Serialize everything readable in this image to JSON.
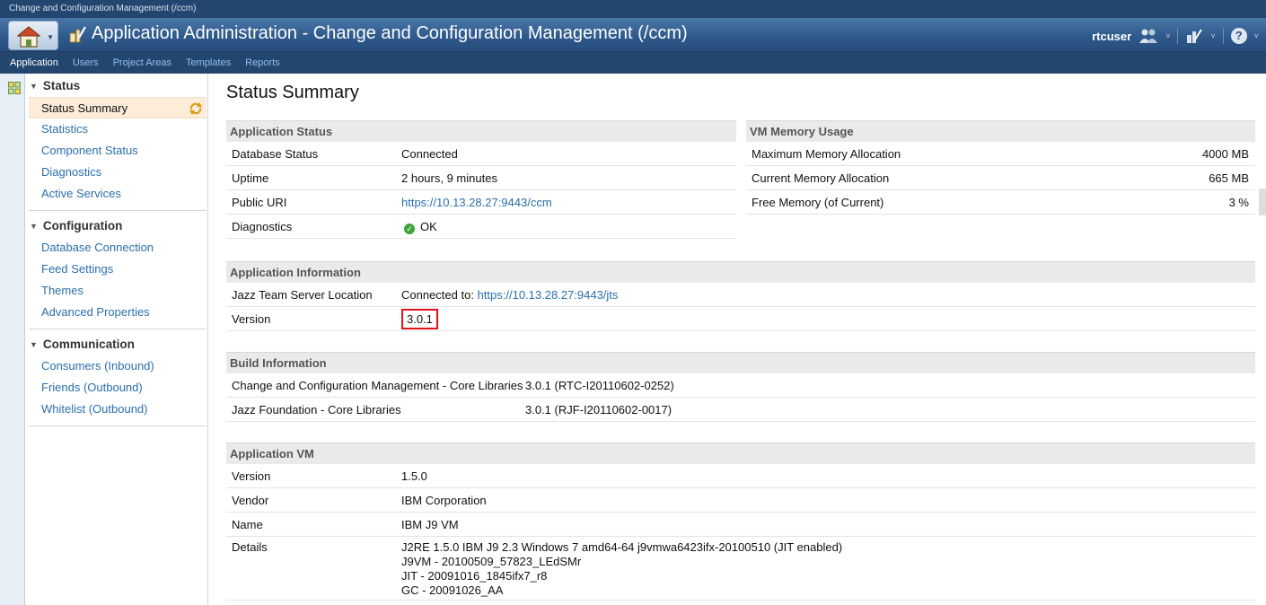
{
  "window": {
    "title": "Change and Configuration Management (/ccm)"
  },
  "banner": {
    "title": "Application Administration - Change and Configuration Management (/ccm)",
    "user": "rtcuser",
    "icons": [
      "home-icon",
      "admin-app-icon",
      "users-group-icon",
      "tools-icon",
      "help-icon"
    ]
  },
  "nav": {
    "tabs": [
      "Application",
      "Users",
      "Project Areas",
      "Templates",
      "Reports"
    ],
    "active": "Application"
  },
  "sidebar": {
    "sections": [
      {
        "title": "Status",
        "items": [
          "Status Summary",
          "Statistics",
          "Component Status",
          "Diagnostics",
          "Active Services"
        ]
      },
      {
        "title": "Configuration",
        "items": [
          "Database Connection",
          "Feed Settings",
          "Themes",
          "Advanced Properties"
        ]
      },
      {
        "title": "Communication",
        "items": [
          "Consumers (Inbound)",
          "Friends (Outbound)",
          "Whitelist (Outbound)"
        ]
      }
    ],
    "selected": "Status Summary"
  },
  "main": {
    "title": "Status Summary",
    "app_status": {
      "heading": "Application Status",
      "rows": [
        {
          "label": "Database Status",
          "value": "Connected"
        },
        {
          "label": "Uptime",
          "value": "2 hours, 9 minutes"
        },
        {
          "label": "Public URI",
          "value": "https://10.13.28.27:9443/ccm"
        },
        {
          "label": "Diagnostics",
          "value": "OK"
        }
      ]
    },
    "vm_memory": {
      "heading": "VM Memory Usage",
      "rows": [
        {
          "label": "Maximum Memory Allocation",
          "value": "4000 MB"
        },
        {
          "label": "Current Memory Allocation",
          "value": "665 MB"
        },
        {
          "label": "Free Memory (of Current)",
          "value": "3 %"
        }
      ]
    },
    "app_info": {
      "heading": "Application Information",
      "jts_label": "Jazz Team Server Location",
      "jts_prefix": "Connected to:",
      "jts_url": "https://10.13.28.27:9443/jts",
      "version_label": "Version",
      "version_value": "3.0.1"
    },
    "build_info": {
      "heading": "Build Information",
      "rows": [
        {
          "label": "Change and Configuration Management - Core Libraries",
          "value": "3.0.1 (RTC-I20110602-0252)"
        },
        {
          "label": "Jazz Foundation - Core Libraries",
          "value": "3.0.1 (RJF-I20110602-0017)"
        }
      ]
    },
    "app_vm": {
      "heading": "Application VM",
      "rows": [
        {
          "label": "Version",
          "value": "1.5.0"
        },
        {
          "label": "Vendor",
          "value": "IBM Corporation"
        },
        {
          "label": "Name",
          "value": "IBM J9 VM"
        }
      ],
      "details_label": "Details",
      "details_lines": [
        "J2RE 1.5.0 IBM J9 2.3 Windows 7 amd64-64 j9vmwa6423ifx-20100510 (JIT enabled)",
        "J9VM - 20100509_57823_LEdSMr",
        "JIT - 20091016_1845ifx7_r8",
        "GC - 20091026_AA"
      ]
    }
  }
}
